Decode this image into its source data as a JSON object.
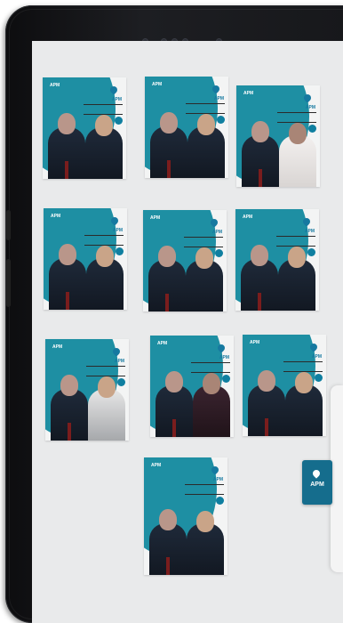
{
  "device": "tablet",
  "app_icon": {
    "label": "APM"
  },
  "posters": [
    {
      "logo_left": "APM",
      "logo_right": "APM"
    },
    {
      "logo_left": "APM",
      "logo_right": "APM"
    },
    {
      "logo_left": "APM",
      "logo_right": "APM"
    },
    {
      "logo_left": "APM",
      "logo_right": "APM"
    },
    {
      "logo_left": "APM",
      "logo_right": "APM"
    },
    {
      "logo_left": "APM",
      "logo_right": "APM"
    },
    {
      "logo_left": "APM",
      "logo_right": "APM"
    },
    {
      "logo_left": "APM",
      "logo_right": "APM"
    },
    {
      "logo_left": "APM",
      "logo_right": "APM"
    },
    {
      "logo_left": "APM",
      "logo_right": "APM"
    }
  ]
}
